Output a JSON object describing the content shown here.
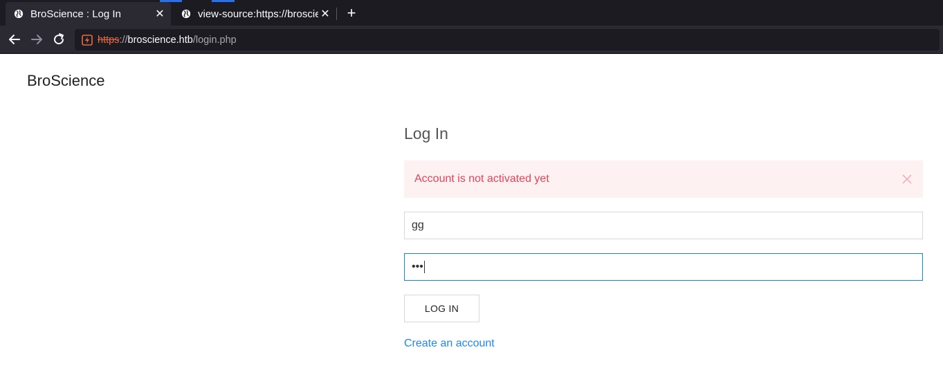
{
  "browser": {
    "tabs": [
      {
        "title": "BroScience : Log In",
        "active": true
      },
      {
        "title": "view-source:https://broscience.htb",
        "active": false
      }
    ],
    "new_tab": "+",
    "url": {
      "protocol": "https",
      "separator": "://",
      "host": "broscience.htb",
      "path": "/login.php"
    },
    "colors": {
      "chrome_dark": "#1c1b22",
      "chrome_mid": "#2b2a33",
      "insecure": "#e66b4a"
    }
  },
  "page": {
    "brand": "BroScience",
    "heading": "Log In",
    "alert": {
      "message": "Account is not activated yet",
      "color": "#e0455b",
      "background": "#fef1f2"
    },
    "username_value": "gg",
    "password_value": "•••",
    "login_button": "LOG IN",
    "create_account_link": "Create an account",
    "accent": "#1e87f0"
  }
}
